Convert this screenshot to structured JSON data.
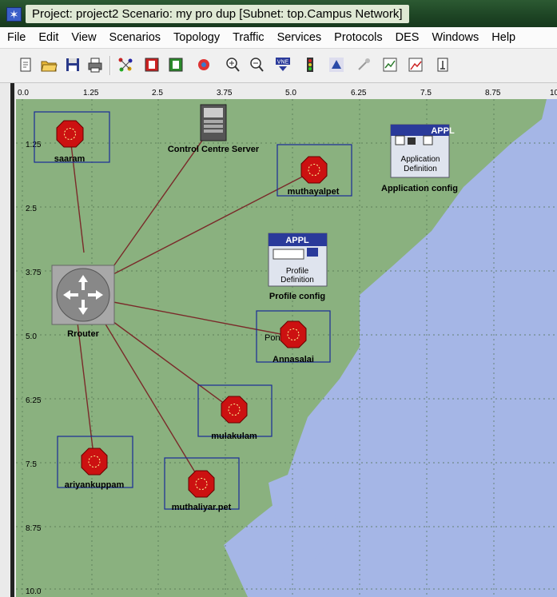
{
  "window": {
    "title": "Project: project2 Scenario: my pro dup  [Subnet: top.Campus Network]"
  },
  "menu": [
    "File",
    "Edit",
    "View",
    "Scenarios",
    "Topology",
    "Traffic",
    "Services",
    "Protocols",
    "DES",
    "Windows",
    "Help"
  ],
  "toolbar": [
    "new-icon",
    "open-folder-icon",
    "save-icon",
    "print-icon",
    "rapid-config-icon",
    "deploy-icon",
    "configure-icon",
    "fail-recover-icon",
    "zoom-in-icon",
    "zoom-out-icon",
    "vne-icon",
    "traffic-light-icon",
    "triangle-icon",
    "cancel-icon",
    "view-results-icon",
    "edit-graph-icon",
    "info-icon"
  ],
  "toolbar_vne_text": "VNE",
  "ruler": {
    "x_ticks": [
      "0.0",
      "1.25",
      "2.5",
      "3.75",
      "5.0",
      "6.25",
      "7.5",
      "8.75",
      "10"
    ],
    "y_ticks": [
      "1.25",
      "2.5",
      "3.75",
      "5.0",
      "6.25",
      "7.5",
      "8.75",
      "10.0"
    ]
  },
  "colors": {
    "land": "#8ab17f",
    "water": "#a5b6e6",
    "router_red": "#cc1111",
    "link": "#7a2a2a",
    "selection": "#1a2a99",
    "grid": "#5f7f5f"
  },
  "nodes": {
    "saaram": "saaram",
    "server": "Control Centre Server",
    "muthayalpet": "muthayalpet",
    "app_badge": "APPL",
    "app_text1": "Application",
    "app_text2": "Definition",
    "app_label": "Application config",
    "profile_badge": "APPL",
    "profile_text1": "Profile",
    "profile_text2": "Definition",
    "profile_label": "Profile config",
    "router": "Rrouter",
    "annasalai": "Annasalai",
    "annasalai_overlap": "Pondy  y",
    "mulakulam": "mulakulam",
    "ariyankuppam": "ariyankuppam",
    "muthaliyarpet": "muthaliyar.pet"
  }
}
